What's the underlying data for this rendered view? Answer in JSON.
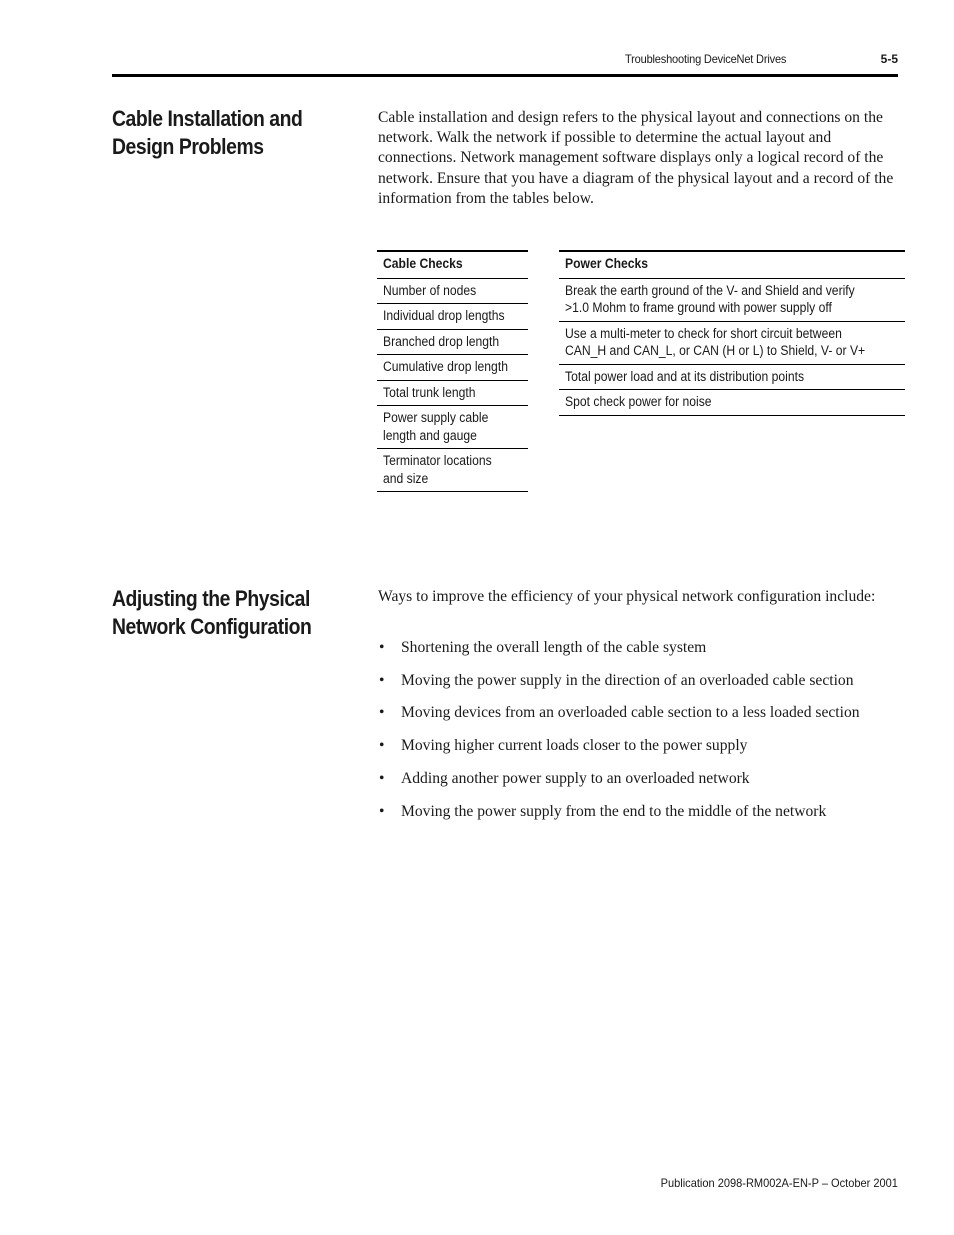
{
  "header": {
    "running_title": "Troubleshooting DeviceNet Drives",
    "page_number": "5-5"
  },
  "sections": [
    {
      "title_line1": "Cable Installation and",
      "title_line2": "Design Problems",
      "paragraph": "Cable installation and design refers to the physical layout and connections on the network. Walk the network if possible to determine the actual layout and connections. Network management software displays only a logical record of the network. Ensure that you have a diagram of the physical layout and a record of the information from the tables below."
    },
    {
      "title_line1": "Adjusting the Physical",
      "title_line2": "Network Configuration",
      "paragraph": "Ways to improve the efficiency of your physical network configuration include:",
      "bullets": [
        "Shortening the overall length of the cable system",
        "Moving the power supply in the direction of an overloaded cable section",
        "Moving devices from an overloaded cable section to a less loaded section",
        "Moving higher current loads closer to the power supply",
        "Adding another power supply to an overloaded network",
        "Moving the power supply from the end to the middle of the network"
      ]
    }
  ],
  "cable_table": {
    "header": "Cable Checks",
    "rows": [
      [
        "Number of nodes"
      ],
      [
        "Individual drop lengths"
      ],
      [
        "Branched drop length"
      ],
      [
        "Cumulative drop length"
      ],
      [
        "Total trunk length"
      ],
      [
        "Power supply cable",
        "length and gauge"
      ],
      [
        "Terminator locations",
        "and size"
      ]
    ]
  },
  "power_table": {
    "header": "Power Checks",
    "rows": [
      [
        "Break the earth ground of the V- and Shield and verify",
        ">1.0 Mohm to frame ground with power supply off"
      ],
      [
        "Use a multi-meter to check for short circuit between",
        "CAN_H and CAN_L, or CAN (H or L) to Shield, V- or V+"
      ],
      [
        "Total power load and at its distribution points"
      ],
      [
        "Spot check power for noise"
      ]
    ]
  },
  "bullet_glyph": "•",
  "footer": {
    "publication": "Publication 2098-RM002A-EN-P – October 2001"
  }
}
